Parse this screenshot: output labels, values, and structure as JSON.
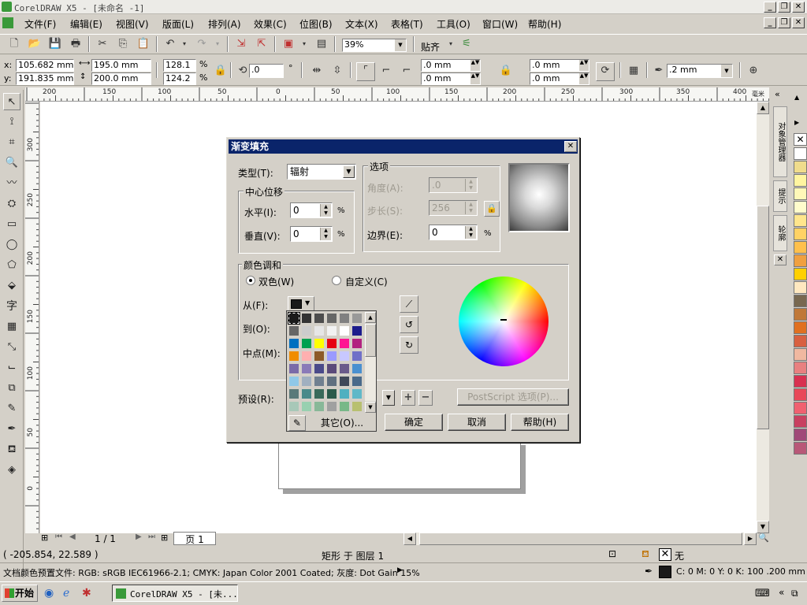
{
  "window": {
    "title": "CorelDRAW X5 - [未命名 -1]",
    "controls": [
      "_",
      "❐",
      "✕"
    ]
  },
  "doc_controls": [
    "_",
    "❐",
    "✕"
  ],
  "menu": [
    "文件(F)",
    "编辑(E)",
    "视图(V)",
    "版面(L)",
    "排列(A)",
    "效果(C)",
    "位图(B)",
    "文本(X)",
    "表格(T)",
    "工具(O)",
    "窗口(W)",
    "帮助(H)"
  ],
  "toolbar": {
    "zoom": "39%",
    "snap_label": "贴齐"
  },
  "property_bar": {
    "x": "105.682 mm",
    "y": "191.835 mm",
    "width": "195.0 mm",
    "height": "200.0 mm",
    "scale_x": "128.1",
    "scale_y": "124.2",
    "percent": "%",
    "rotation": ".0",
    "degree": "°",
    "corner1": ".0 mm",
    "corner2": ".0 mm",
    "corner3": ".0 mm",
    "corner4": ".0 mm",
    "outline_width": ".2 mm"
  },
  "ruler": {
    "unit": "毫米",
    "h_labels": [
      "200",
      "150",
      "100",
      "50",
      "0",
      "50",
      "100",
      "150",
      "200",
      "250",
      "300",
      "350",
      "400"
    ],
    "v_labels": [
      "300",
      "250",
      "200",
      "150",
      "100",
      "50",
      "0"
    ]
  },
  "dockers": [
    "对象管理器",
    "提示",
    "轮廓"
  ],
  "dialog": {
    "title": "渐变填充",
    "type_label": "类型(T):",
    "type_value": "辐射",
    "center_group": "中心位移",
    "horizontal_label": "水平(I):",
    "horizontal_value": "0",
    "vertical_label": "垂直(V):",
    "vertical_value": "0",
    "options_group": "选项",
    "angle_label": "角度(A):",
    "angle_value": ".0",
    "steps_label": "步长(S):",
    "steps_value": "256",
    "edge_label": "边界(E):",
    "edge_value": "0",
    "percent": "%",
    "blend_group": "颜色调和",
    "two_color": "双色(W)",
    "custom": "自定义(C)",
    "from_label": "从(F):",
    "to_label": "到(O):",
    "mid_label": "中点(M):",
    "presets_label": "预设(R):",
    "postscript_button": "PostScript 选项(P)...",
    "ok_button": "确定",
    "cancel_button": "取消",
    "help_button": "帮助(H)",
    "other_button": "其它(O)...",
    "close": "✕"
  },
  "picker_colors": [
    [
      "#1a1a1a",
      "#333333",
      "#4d4d4d",
      "#666666",
      "#808080",
      "#999999",
      "#b3b3b3"
    ],
    [
      "#666666",
      "#cccccc",
      "#e6e6e6",
      "#f2f2f2",
      "#ffffff",
      "#1c1c8c",
      "#ffffff"
    ],
    [
      "#0070c0",
      "#00a050",
      "#ffff00",
      "#e60012",
      "#ff1493",
      "#b22280",
      "#ffffff"
    ],
    [
      "#f08c00",
      "#ffb0b0",
      "#8c5a28",
      "#9a9aff",
      "#c8c8ff",
      "#7070c8",
      "#ffffff"
    ],
    [
      "#7a6aa8",
      "#8a7ab8",
      "#4a4a8a",
      "#5a4a7a",
      "#6a5a8a",
      "#4a90d0",
      "#ffffff"
    ],
    [
      "#90c8e8",
      "#a0b0c0",
      "#708090",
      "#607080",
      "#404858",
      "#4a6a8a",
      "#ffffff"
    ],
    [
      "#5a7a7a",
      "#4a8a8a",
      "#3a6a5a",
      "#2a5a4a",
      "#50b0c0",
      "#60b8c8",
      "#ffffff"
    ],
    [
      "#a8c8b8",
      "#98d0b0",
      "#88b898",
      "#a0a0a0",
      "#78b888",
      "#b8c070",
      "#ffffff"
    ]
  ],
  "palette_colors": [
    "#ffffff",
    "#f0dc8c",
    "#fff5a0",
    "#fff8b8",
    "#fffccc",
    "#ffe68c",
    "#ffd264",
    "#ffc04c",
    "#f0a040",
    "#ffd000",
    "#ffe8c0",
    "#786850",
    "#c07838",
    "#e07020",
    "#d86040",
    "#f0b8a0",
    "#e88080",
    "#d83050",
    "#e84858",
    "#f06070",
    "#c84060",
    "#a04878",
    "#b85878"
  ],
  "status": {
    "coords": "( -205.854, 22.589 )",
    "object": "矩形 于 图层 1",
    "fill": "无",
    "profile": "文档颜色预置文件: RGB: sRGB IEC61966-2.1; CMYK: Japan Color 2001 Coated; 灰度: Dot Gain 15%",
    "outline": "C: 0 M: 0 Y: 0 K: 100  .200 mm"
  },
  "pages": {
    "counter": "1 / 1",
    "tab": "页 1"
  },
  "taskbar": {
    "start": "开始",
    "task": "CorelDRAW X5 - [未..."
  }
}
